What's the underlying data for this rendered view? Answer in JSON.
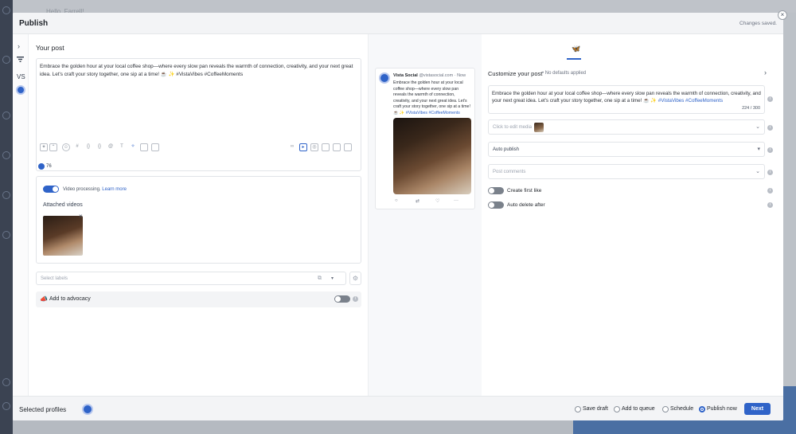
{
  "background": {
    "greeting": "Hello, Farrell!"
  },
  "modal": {
    "title": "Publish",
    "status": "Changes saved.",
    "close": "×"
  },
  "rail": {
    "profile_initials": "VS"
  },
  "editor": {
    "label": "Your post",
    "text": "Embrace the golden hour at your local coffee shop—where every slow pan reveals the warmth of connection, creativity, and your next great idea. Let's craft your story together, one sip at a time! ☕ ✨ #VistaVibes #CoffeeMoments",
    "char_remaining": "76"
  },
  "media": {
    "toggle_label": "Video processing.",
    "learn_more": "Learn more",
    "attached_title": "Attached videos",
    "remove": "×"
  },
  "labels": {
    "placeholder": "Select labels"
  },
  "advocacy": {
    "label": "Add to advocacy"
  },
  "preview": {
    "name": "Vista Social",
    "handle": "@vistasocial.com · Now",
    "text": "Embrace the golden hour at your local coffee shop—where every slow pan reveals the warmth of connection, creativity, and your next great idea. Let's craft your story together, one sip at a time! ☕ ✨",
    "tag1": "#VistaVibes",
    "tag2": "#CoffeeMoments"
  },
  "customize": {
    "title": "Customize your post",
    "subtitle": "• No defaults applied",
    "text": "Embrace the golden hour at your local coffee shop—where every slow pan reveals the warmth of connection, creativity, and your next great idea. Let's craft your story together, one sip at a time! ☕ ✨",
    "tags": "#VistaVibes #CoffeeMoments",
    "counter": "224 / 300",
    "media_placeholder": "Click to edit media",
    "publish_mode": "Auto publish",
    "comments_placeholder": "Post comments",
    "first_like": "Create first like",
    "auto_delete": "Auto delete after"
  },
  "footer": {
    "selected_profiles": "Selected profiles",
    "options": [
      {
        "label": "Save draft",
        "selected": false
      },
      {
        "label": "Add to queue",
        "selected": false
      },
      {
        "label": "Schedule",
        "selected": false
      },
      {
        "label": "Publish now",
        "selected": true
      }
    ],
    "next": "Next"
  },
  "colors": {
    "accent": "#2f63c8"
  }
}
